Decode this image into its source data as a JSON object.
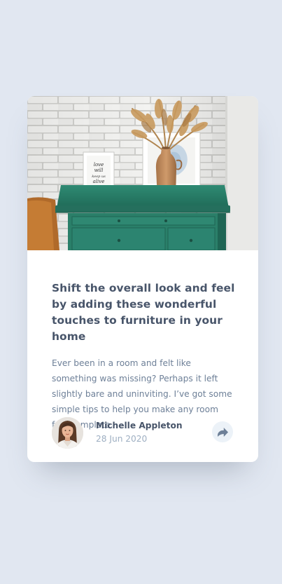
{
  "article": {
    "title": "Shift the overall look and feel by adding these wonderful touches to furniture in your home",
    "excerpt": "Ever been in a room and felt like something was missing? Perhaps it left slightly bare and uninviting. I’ve got some simple tips to help you make any room feel complete.",
    "hero_icon": "photo-of-green-drawers-with-vase"
  },
  "author": {
    "name": "Michelle Appleton",
    "date": "28 Jun 2020",
    "avatar_icon": "avatar-portrait"
  },
  "share": {
    "icon": "share-icon"
  },
  "colors": {
    "background": "#e1e7f1",
    "card": "#ffffff",
    "heading": "#48556a",
    "body_text": "#6e8098",
    "muted": "#9eafc2",
    "share_bg": "#ecf2f8",
    "drawer_green": "#2c7d69"
  }
}
